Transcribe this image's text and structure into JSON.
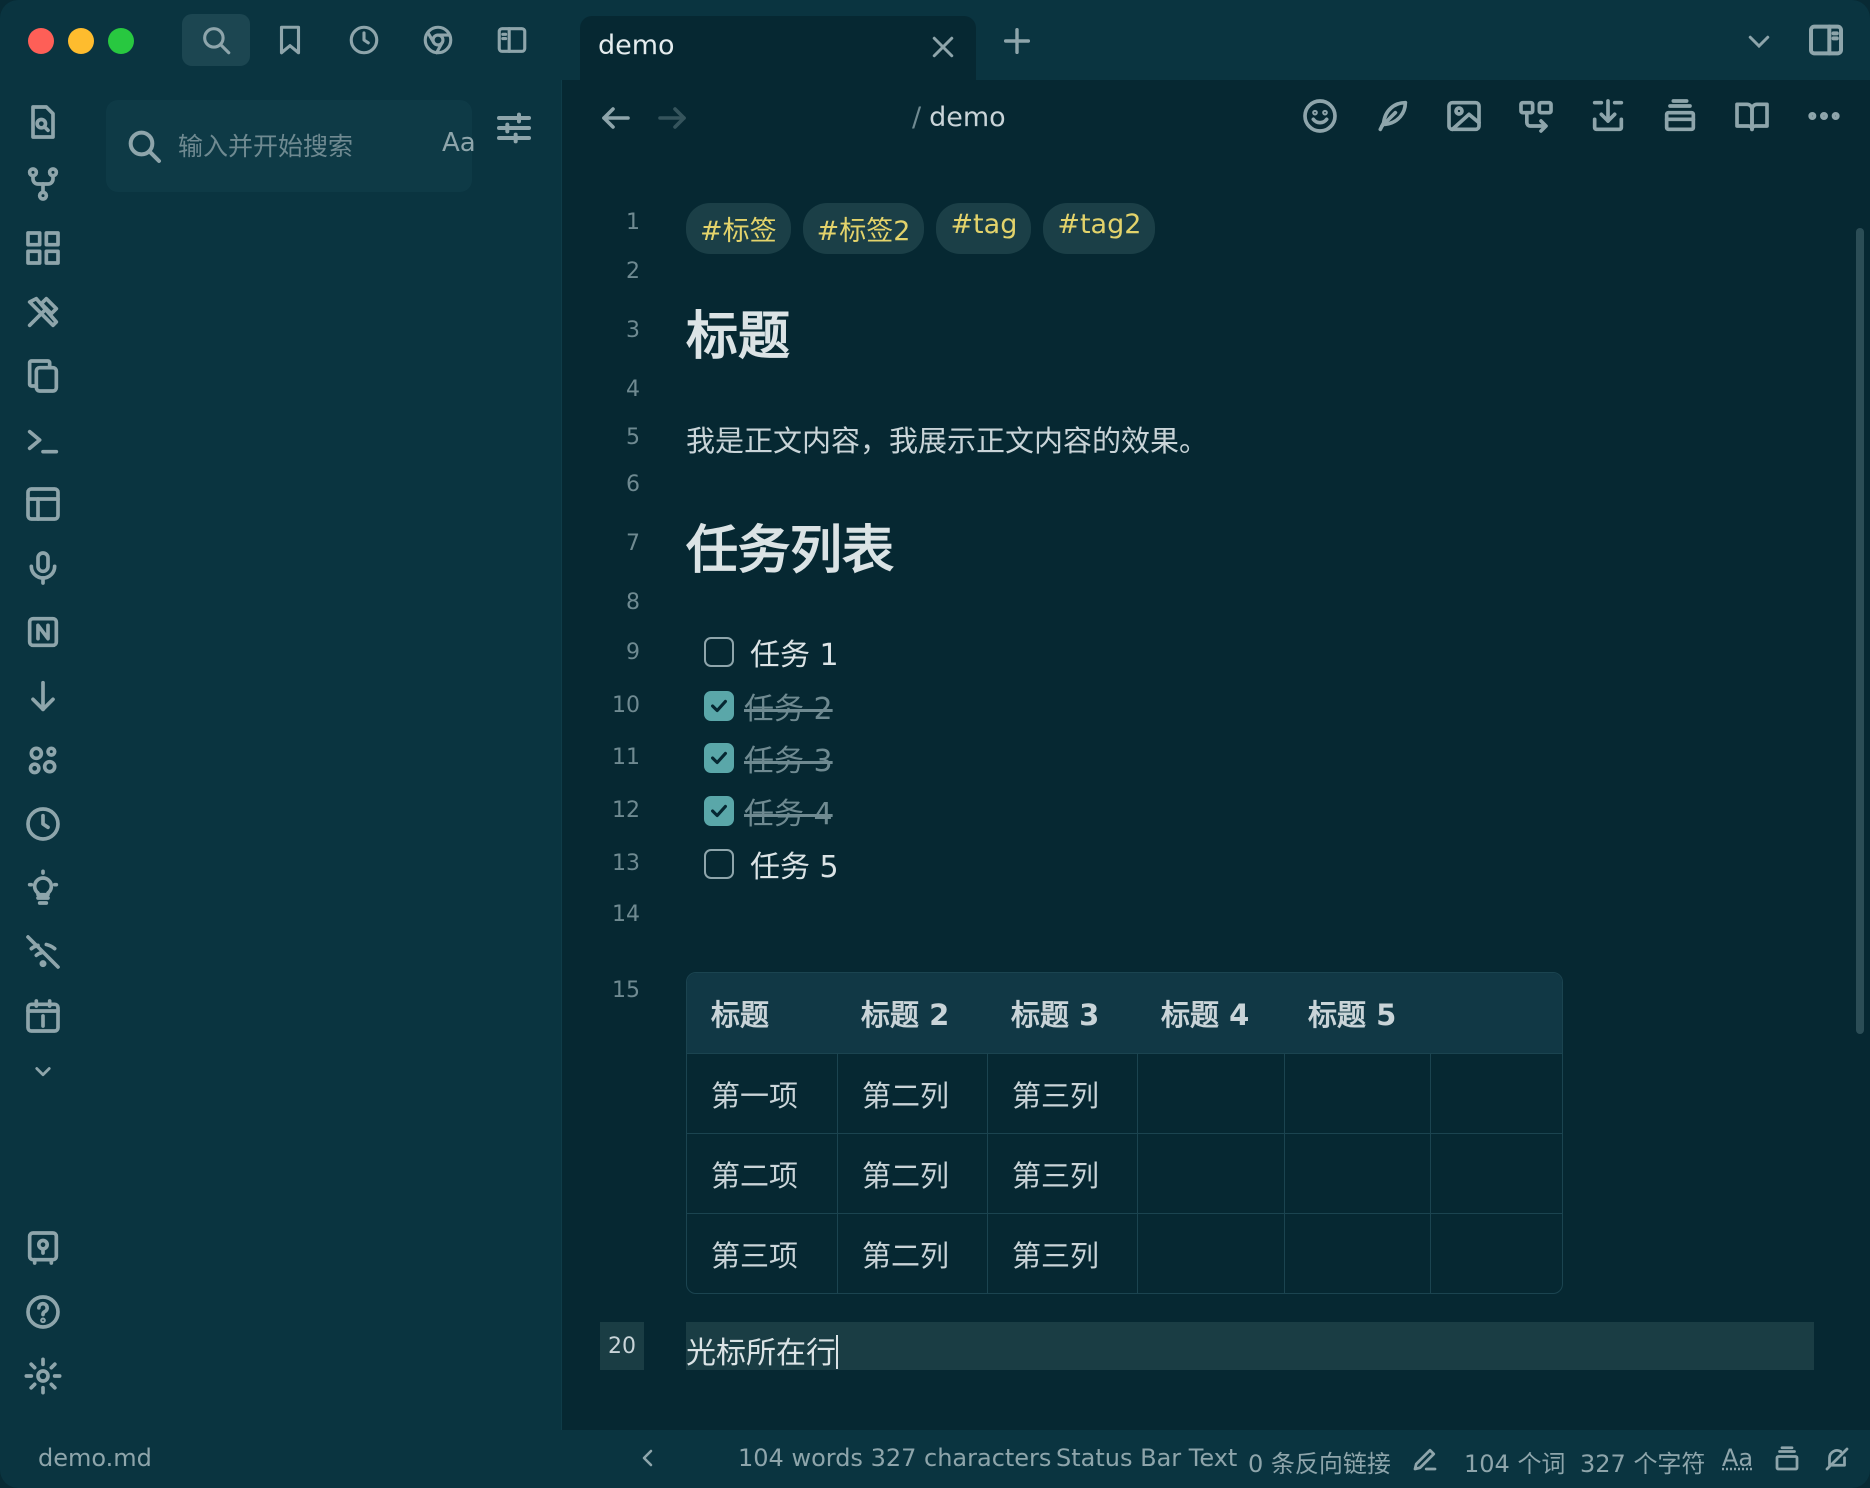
{
  "tabs": [
    {
      "title": "demo"
    }
  ],
  "sidebar": {
    "search": {
      "placeholder": "输入并开始搜索",
      "value": "",
      "case_label": "Aa"
    }
  },
  "editor": {
    "breadcrumb": {
      "separator": "/",
      "file": "demo"
    },
    "line_numbers": [
      "1",
      "2",
      "3",
      "4",
      "5",
      "6",
      "7",
      "8",
      "9",
      "10",
      "11",
      "12",
      "13",
      "14",
      "15",
      "20"
    ],
    "tags": [
      "#标签",
      "#标签2",
      "#tag",
      "#tag2"
    ],
    "heading1": "标题",
    "paragraph": "我是正文内容，我展示正文内容的效果。",
    "heading2": "任务列表",
    "tasks": [
      {
        "text": "任务 1",
        "done": false
      },
      {
        "text": "任务 2",
        "done": true
      },
      {
        "text": "任务 3",
        "done": true
      },
      {
        "text": "任务 4",
        "done": true
      },
      {
        "text": "任务 5",
        "done": false
      }
    ],
    "table": {
      "headers": [
        "标题",
        "标题 2",
        "标题 3",
        "标题 4",
        "标题 5",
        ""
      ],
      "rows": [
        [
          "第一项",
          "第二列",
          "第三列",
          "",
          "",
          ""
        ],
        [
          "第二项",
          "第二列",
          "第三列",
          "",
          "",
          ""
        ],
        [
          "第三项",
          "第二列",
          "第三列",
          "",
          "",
          ""
        ]
      ]
    },
    "cursor_line": "光标所在行"
  },
  "statusbar": {
    "file": "demo.md",
    "word_count_en": "104 words 327 characters",
    "custom_text": "Status Bar Text",
    "backlinks": "0 条反向链接",
    "word_count_zh": "104 个词",
    "char_count_zh": "327 个字符",
    "font_toggle": "Aa"
  },
  "colors": {
    "background": "#062832",
    "tag_text": "#e3d36b",
    "checkbox_checked": "#5aa7a9"
  }
}
